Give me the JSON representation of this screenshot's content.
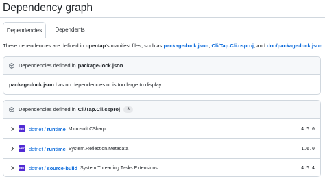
{
  "page": {
    "title": "Dependency graph",
    "tabs": [
      {
        "label": "Dependencies",
        "active": true
      },
      {
        "label": "Dependents",
        "active": false
      }
    ]
  },
  "intro": {
    "prefix": "These dependencies are defined in ",
    "repo": "opentap",
    "middle": "'s manifest files, such as ",
    "link1": "package-lock.json",
    "sep1": ", ",
    "link2": "Cli/Tap.Cli.csproj",
    "sep2": ", and ",
    "link3": "doc/package-lock.json",
    "suffix": "."
  },
  "manifests": [
    {
      "header_prefix": "Dependencies defined in",
      "file": "package-lock.json",
      "body_file": "package-lock.json",
      "body_text": " has no dependencies or is too large to display"
    },
    {
      "header_prefix": "Dependencies defined in",
      "file": "Cli/Tap.Cli.csproj",
      "count": "3",
      "dependencies": [
        {
          "avatar": "NET",
          "ecosystem": "dotnet",
          "scope": "runtime",
          "name": "Microsoft.CSharp",
          "version": "4.5.0"
        },
        {
          "avatar": "NET",
          "ecosystem": "dotnet",
          "scope": "runtime",
          "name": "System.Reflection.Metadata",
          "version": "1.6.0"
        },
        {
          "avatar": "NET",
          "ecosystem": "dotnet",
          "scope": "source-build",
          "name": "System.Threading.Tasks.Extensions",
          "version": "4.5.4"
        }
      ]
    }
  ],
  "icons": {
    "package": "package-icon",
    "chevron": "chevron-right-icon",
    "avatar": "dotnet-avatar"
  },
  "colors": {
    "link": "#0969da",
    "border": "#d0d7de",
    "header_bg": "#f6f8fa",
    "dotnet_purple": "#512bd4"
  }
}
